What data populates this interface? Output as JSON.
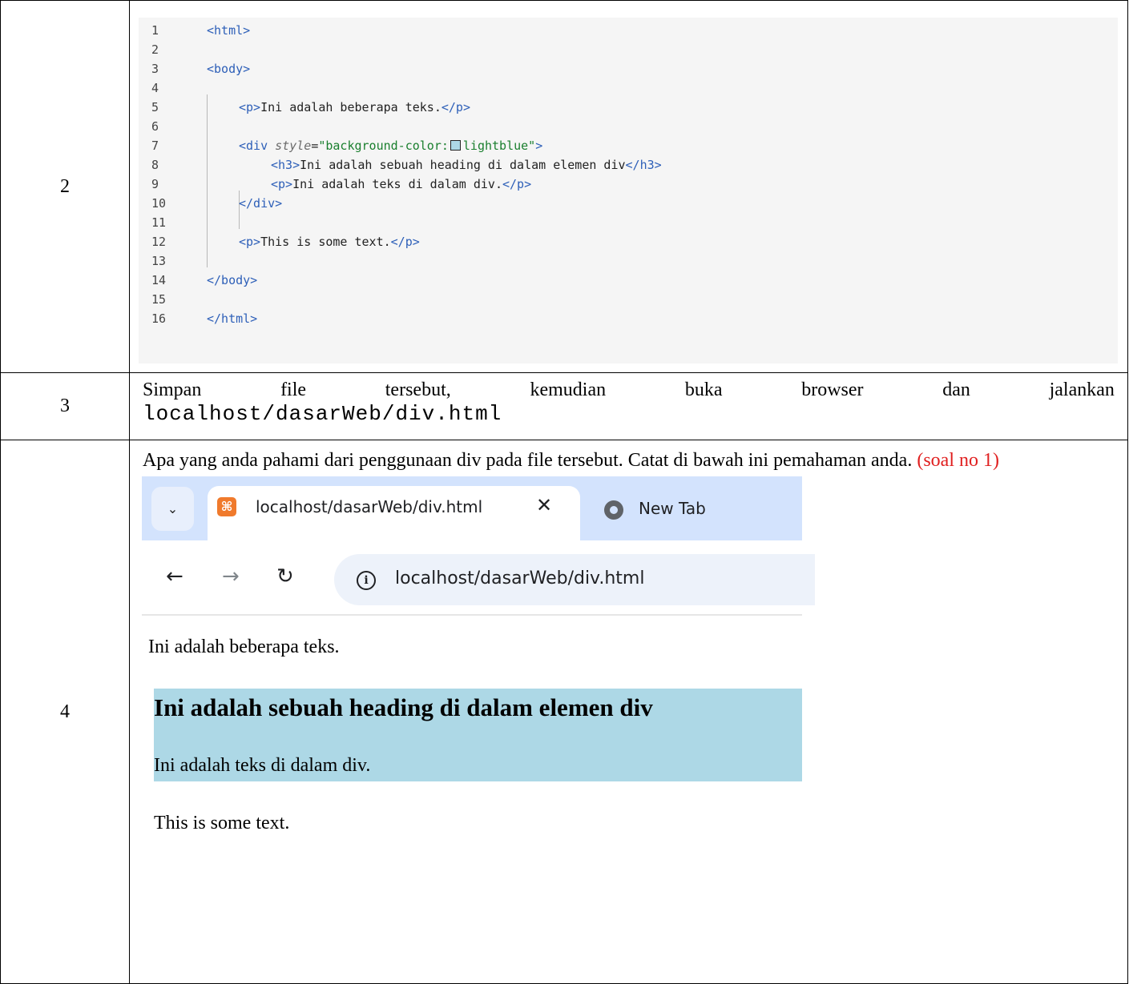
{
  "rows": [
    {
      "number": "2"
    },
    {
      "number": "3",
      "words": [
        "Simpan",
        "file",
        "tersebut,",
        "kemudian",
        "buka",
        "browser",
        "dan",
        "jalankan"
      ],
      "path": "localhost/dasarWeb/div.html"
    },
    {
      "number": "4",
      "instruction": "Apa yang anda pahami dari penggunaan div pada file tersebut. Catat di bawah ini pemahaman anda.",
      "note": "(soal no 1)"
    }
  ],
  "code": {
    "lines": [
      {
        "n": "1",
        "indent": 0,
        "parts": [
          {
            "t": "<html>",
            "c": "tag"
          }
        ]
      },
      {
        "n": "2",
        "indent": 0,
        "parts": []
      },
      {
        "n": "3",
        "indent": 0,
        "parts": [
          {
            "t": "<body>",
            "c": "tag"
          }
        ]
      },
      {
        "n": "4",
        "indent": 0,
        "parts": []
      },
      {
        "n": "5",
        "indent": 1,
        "parts": [
          {
            "t": "<p>",
            "c": "tag"
          },
          {
            "t": "Ini adalah beberapa teks.",
            "c": "txt"
          },
          {
            "t": "</p>",
            "c": "tag"
          }
        ]
      },
      {
        "n": "6",
        "indent": 0,
        "parts": []
      },
      {
        "n": "7",
        "indent": 1,
        "parts": [
          {
            "t": "<div ",
            "c": "tag"
          },
          {
            "t": "style",
            "c": "attr"
          },
          {
            "t": "=",
            "c": "txt"
          },
          {
            "t": "\"background-color:",
            "c": "str"
          },
          {
            "t": "",
            "c": "swatch"
          },
          {
            "t": "lightblue\"",
            "c": "str"
          },
          {
            "t": ">",
            "c": "tag"
          }
        ]
      },
      {
        "n": "8",
        "indent": 2,
        "parts": [
          {
            "t": "<h3>",
            "c": "tag"
          },
          {
            "t": "Ini adalah sebuah heading di dalam elemen div",
            "c": "txt"
          },
          {
            "t": "</h3>",
            "c": "tag"
          }
        ]
      },
      {
        "n": "9",
        "indent": 2,
        "parts": [
          {
            "t": "<p>",
            "c": "tag"
          },
          {
            "t": "Ini adalah teks di dalam div.",
            "c": "txt"
          },
          {
            "t": "</p>",
            "c": "tag"
          }
        ]
      },
      {
        "n": "10",
        "indent": 1,
        "parts": [
          {
            "t": "</div>",
            "c": "tag"
          }
        ]
      },
      {
        "n": "11",
        "indent": 0,
        "parts": []
      },
      {
        "n": "12",
        "indent": 1,
        "parts": [
          {
            "t": "<p>",
            "c": "tag"
          },
          {
            "t": "This is some text.",
            "c": "txt"
          },
          {
            "t": "</p>",
            "c": "tag"
          }
        ]
      },
      {
        "n": "13",
        "indent": 0,
        "parts": []
      },
      {
        "n": "14",
        "indent": 0,
        "parts": [
          {
            "t": "</body>",
            "c": "tag"
          }
        ]
      },
      {
        "n": "15",
        "indent": 0,
        "parts": []
      },
      {
        "n": "16",
        "indent": 0,
        "parts": [
          {
            "t": "</html>",
            "c": "tag"
          }
        ]
      }
    ],
    "colors": {
      "tag": "#2d5fb8",
      "attr": "#6b6b6b",
      "string": "#1a7f2e",
      "swatch": "#add8e6"
    }
  },
  "browser": {
    "active_tab": "localhost/dasarWeb/div.html",
    "active_tab_icon": "xampp-favicon-icon",
    "inactive_tab": "New Tab",
    "inactive_tab_icon": "chrome-icon",
    "url": "localhost/dasarWeb/div.html",
    "page": {
      "p1": "Ini adalah beberapa teks.",
      "h3": "Ini adalah sebuah heading di dalam elemen div",
      "p2": "Ini adalah teks di dalam div.",
      "p3": "This is some text."
    },
    "colors": {
      "tabstrip": "#d3e3fd",
      "omnibox": "#edf2fa",
      "div_background": "#add8e6"
    }
  }
}
